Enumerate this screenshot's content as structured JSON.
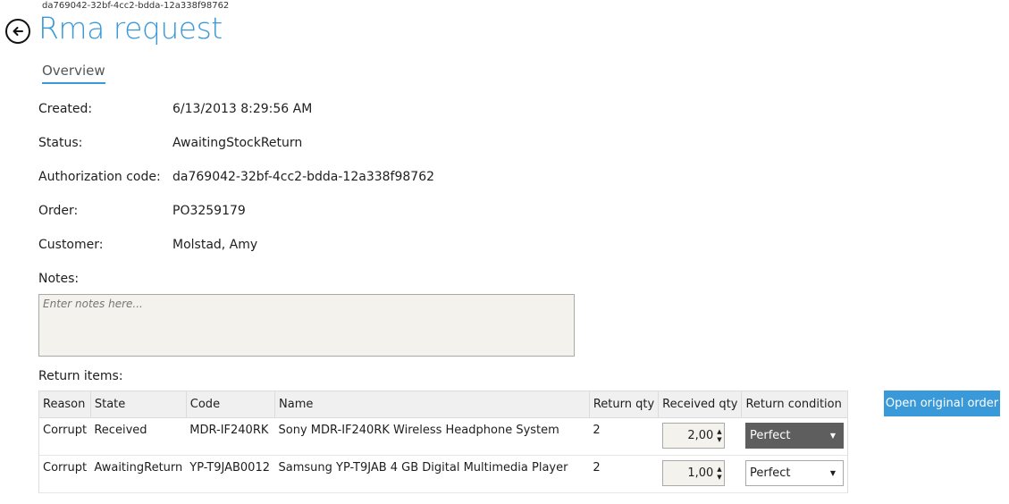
{
  "header": {
    "top_id": "da769042-32bf-4cc2-bdda-12a338f98762",
    "title": "Rma request",
    "back_icon": "back-arrow-icon"
  },
  "tabs": [
    {
      "label": "Overview"
    }
  ],
  "fields": {
    "created": {
      "label": "Created:",
      "value": "6/13/2013 8:29:56 AM"
    },
    "status": {
      "label": "Status:",
      "value": "AwaitingStockReturn"
    },
    "auth": {
      "label": "Authorization code:",
      "value": "da769042-32bf-4cc2-bdda-12a338f98762"
    },
    "order": {
      "label": "Order:",
      "value": "PO3259179"
    },
    "customer": {
      "label": "Customer:",
      "value": "Molstad, Amy"
    }
  },
  "notes": {
    "label": "Notes:",
    "placeholder": "Enter notes here..."
  },
  "items": {
    "label": "Return items:",
    "columns": [
      "Reason",
      "State",
      "Code",
      "Name",
      "Return qty",
      "Received qty",
      "Return condition"
    ],
    "rows": [
      {
        "reason": "Corrupt",
        "state": "Received",
        "code": "MDR-IF240RK",
        "name": "Sony MDR-IF240RK Wireless Headphone System",
        "return_qty": "2",
        "received_qty": "2,00",
        "condition": "Perfect"
      },
      {
        "reason": "Corrupt",
        "state": "AwaitingReturn",
        "code": "YP-T9JAB0012",
        "name": "Samsung YP-T9JAB 4 GB Digital Multimedia Player",
        "return_qty": "2",
        "received_qty": "1,00",
        "condition": "Perfect"
      }
    ]
  },
  "actions": {
    "open_original_order": "Open original order"
  },
  "colors": {
    "accent": "#3a99d8",
    "notes_bg": "#f4f2ec",
    "selected_dropdown": "#5e5e5e"
  }
}
